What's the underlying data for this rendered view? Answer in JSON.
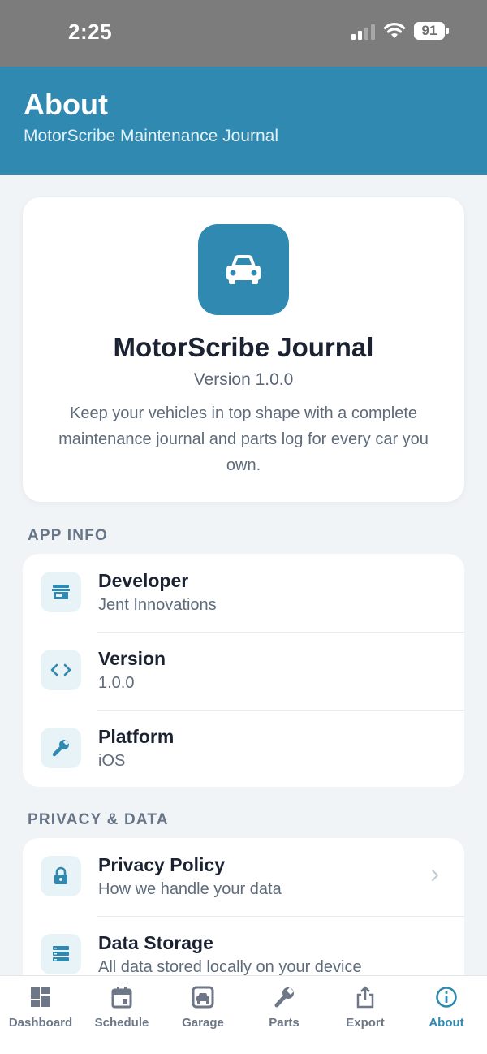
{
  "status_bar": {
    "time": "2:25",
    "battery": "91"
  },
  "header": {
    "title": "About",
    "subtitle": "MotorScribe Maintenance Journal"
  },
  "hero": {
    "icon": "car-icon",
    "app_name": "MotorScribe Journal",
    "version": "Version 1.0.0",
    "description": "Keep your vehicles in top shape with a complete maintenance journal and parts log for every car you own."
  },
  "app_info": {
    "label": "APP INFO",
    "rows": [
      {
        "icon": "store-icon",
        "title": "Developer",
        "subtitle": "Jent Innovations"
      },
      {
        "icon": "code-icon",
        "title": "Version",
        "subtitle": "1.0.0"
      },
      {
        "icon": "wrench-icon",
        "title": "Platform",
        "subtitle": "iOS"
      }
    ]
  },
  "privacy": {
    "label": "PRIVACY & DATA",
    "rows": [
      {
        "icon": "lock-icon",
        "title": "Privacy Policy",
        "subtitle": "How we handle your data"
      },
      {
        "icon": "storage-icon",
        "title": "Data Storage",
        "subtitle": "All data stored locally on your device"
      }
    ]
  },
  "tabs": [
    {
      "label": "Dashboard",
      "icon": "dashboard-icon"
    },
    {
      "label": "Schedule",
      "icon": "calendar-icon"
    },
    {
      "label": "Garage",
      "icon": "garage-icon"
    },
    {
      "label": "Parts",
      "icon": "wrench-icon"
    },
    {
      "label": "Export",
      "icon": "share-icon"
    },
    {
      "label": "About",
      "icon": "info-icon",
      "active": true
    }
  ],
  "colors": {
    "accent": "#2f89b0",
    "header_bg": "#2f89b0",
    "page_bg": "#f1f4f7",
    "status_bar_bg": "#7c7c7c"
  }
}
